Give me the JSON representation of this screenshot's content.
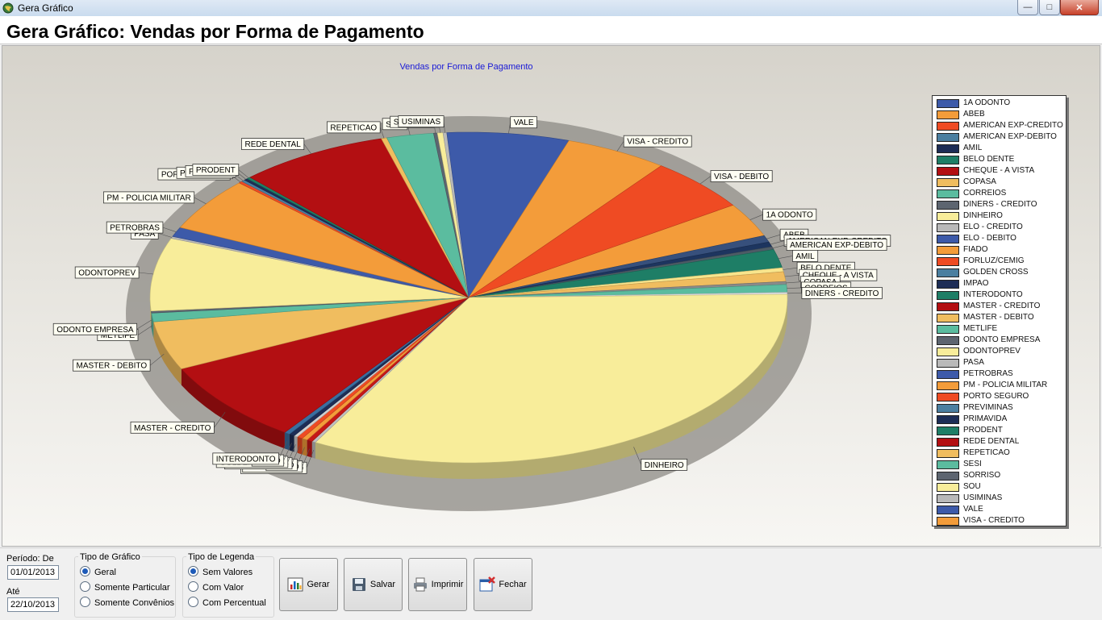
{
  "window": {
    "title": "Gera Gráfico"
  },
  "header": {
    "title": "Gera Gráfico: Vendas por Forma de Pagamento"
  },
  "chart_data": {
    "type": "pie",
    "title": "Vendas por Forma de Pagamento",
    "legend_position": "right",
    "slices": [
      {
        "label": "1A ODONTO",
        "value": 3.5,
        "color": "#f39c3a"
      },
      {
        "label": "ABEB",
        "value": 0.7,
        "color": "#37507c"
      },
      {
        "label": "AMERICAN EXP-CREDITO",
        "value": 0.5,
        "color": "#1d355f"
      },
      {
        "label": "AMERICAN EXP-DEBITO",
        "value": 0.3,
        "color": "#4d5b66"
      },
      {
        "label": "AMIL",
        "value": 1.9,
        "color": "#1e7e66"
      },
      {
        "label": "BELO DENTE",
        "value": 0.4,
        "color": "#f8e58c"
      },
      {
        "label": "CHEQUE - A VISTA",
        "value": 1.0,
        "color": "#f0bd5f"
      },
      {
        "label": "COPASA",
        "value": 0.3,
        "color": "#8a8a8a"
      },
      {
        "label": "CORREIOS",
        "value": 0.8,
        "color": "#5bbc9f"
      },
      {
        "label": "DINERS - CREDITO",
        "value": 0.2,
        "color": "#dcdcdc"
      },
      {
        "label": "DINHEIRO",
        "value": 35.0,
        "color": "#f8ed9a"
      },
      {
        "label": "ELO - CREDITO",
        "value": 0.2,
        "color": "#c0c0c0"
      },
      {
        "label": "ELO - DEBITO",
        "value": 0.3,
        "color": "#c61717"
      },
      {
        "label": "FIADO",
        "value": 0.3,
        "color": "#f39c3a"
      },
      {
        "label": "FORLUZ/CEMIG",
        "value": 0.3,
        "color": "#ef4b23"
      },
      {
        "label": "GOLDEN CROSS",
        "value": 0.2,
        "color": "#d0d0d0"
      },
      {
        "label": "IMPAO",
        "value": 0.3,
        "color": "#1d2d56"
      },
      {
        "label": "INTERODONTO",
        "value": 0.3,
        "color": "#3a6fa0"
      },
      {
        "label": "MASTER - CREDITO",
        "value": 8.5,
        "color": "#b30f12"
      },
      {
        "label": "MASTER - DEBITO",
        "value": 5.0,
        "color": "#f0bd5f"
      },
      {
        "label": "METLIFE",
        "value": 0.9,
        "color": "#5bbc9f"
      },
      {
        "label": "ODONTO EMPRESA",
        "value": 0.2,
        "color": "#5d6570"
      },
      {
        "label": "ODONTOPREV",
        "value": 7.5,
        "color": "#f8ed9a"
      },
      {
        "label": "PASA",
        "value": 0.2,
        "color": "#b9b9b9"
      },
      {
        "label": "PETROBRAS",
        "value": 1.0,
        "color": "#3d5aa9"
      },
      {
        "label": "PM - POLICIA MILITAR",
        "value": 5.5,
        "color": "#f39c3a"
      },
      {
        "label": "PORTO SEGURO",
        "value": 0.2,
        "color": "#ef4b23"
      },
      {
        "label": "PREVIMINAS",
        "value": 0.2,
        "color": "#4b7fa0"
      },
      {
        "label": "PRIMAVIDA",
        "value": 0.2,
        "color": "#1d2d56"
      },
      {
        "label": "PRODENT",
        "value": 0.2,
        "color": "#1e7e66"
      },
      {
        "label": "REDE DENTAL",
        "value": 8.0,
        "color": "#b30f12"
      },
      {
        "label": "REPETICAO",
        "value": 0.3,
        "color": "#f0bd5f"
      },
      {
        "label": "SESI",
        "value": 2.5,
        "color": "#5bbc9f"
      },
      {
        "label": "SORRISO",
        "value": 0.2,
        "color": "#5d6570"
      },
      {
        "label": "SOU",
        "value": 0.3,
        "color": "#f8ed9a"
      },
      {
        "label": "USIMINAS",
        "value": 0.2,
        "color": "#b9b9b9"
      },
      {
        "label": "VALE",
        "value": 6.5,
        "color": "#3d5aa9"
      },
      {
        "label": "VISA - CREDITO",
        "value": 5.5,
        "color": "#f39c3a"
      },
      {
        "label": "VISA - DEBITO",
        "value": 5.5,
        "color": "#ef4b23"
      }
    ]
  },
  "legend": {
    "items": [
      {
        "label": "1A ODONTO",
        "color": "#3d5aa9"
      },
      {
        "label": "ABEB",
        "color": "#f39c3a"
      },
      {
        "label": "AMERICAN EXP-CREDITO",
        "color": "#ef4b23"
      },
      {
        "label": "AMERICAN EXP-DEBITO",
        "color": "#4b7fa0"
      },
      {
        "label": "AMIL",
        "color": "#1d2d56"
      },
      {
        "label": "BELO DENTE",
        "color": "#1e7e66"
      },
      {
        "label": "CHEQUE - A VISTA",
        "color": "#b30f12"
      },
      {
        "label": "COPASA",
        "color": "#f0bd5f"
      },
      {
        "label": "CORREIOS",
        "color": "#5bbc9f"
      },
      {
        "label": "DINERS - CREDITO",
        "color": "#5d6570"
      },
      {
        "label": "DINHEIRO",
        "color": "#f8ed9a"
      },
      {
        "label": "ELO - CREDITO",
        "color": "#b9b9b9"
      },
      {
        "label": "ELO - DEBITO",
        "color": "#3d5aa9"
      },
      {
        "label": "FIADO",
        "color": "#f39c3a"
      },
      {
        "label": "FORLUZ/CEMIG",
        "color": "#ef4b23"
      },
      {
        "label": "GOLDEN CROSS",
        "color": "#4b7fa0"
      },
      {
        "label": "IMPAO",
        "color": "#1d2d56"
      },
      {
        "label": "INTERODONTO",
        "color": "#1e7e66"
      },
      {
        "label": "MASTER - CREDITO",
        "color": "#b30f12"
      },
      {
        "label": "MASTER - DEBITO",
        "color": "#f0bd5f"
      },
      {
        "label": "METLIFE",
        "color": "#5bbc9f"
      },
      {
        "label": "ODONTO EMPRESA",
        "color": "#5d6570"
      },
      {
        "label": "ODONTOPREV",
        "color": "#f8ed9a"
      },
      {
        "label": "PASA",
        "color": "#b9b9b9"
      },
      {
        "label": "PETROBRAS",
        "color": "#3d5aa9"
      },
      {
        "label": "PM - POLICIA MILITAR",
        "color": "#f39c3a"
      },
      {
        "label": "PORTO SEGURO",
        "color": "#ef4b23"
      },
      {
        "label": "PREVIMINAS",
        "color": "#4b7fa0"
      },
      {
        "label": "PRIMAVIDA",
        "color": "#1d2d56"
      },
      {
        "label": "PRODENT",
        "color": "#1e7e66"
      },
      {
        "label": "REDE DENTAL",
        "color": "#b30f12"
      },
      {
        "label": "REPETICAO",
        "color": "#f0bd5f"
      },
      {
        "label": "SESI",
        "color": "#5bbc9f"
      },
      {
        "label": "SORRISO",
        "color": "#5d6570"
      },
      {
        "label": "SOU",
        "color": "#f8ed9a"
      },
      {
        "label": "USIMINAS",
        "color": "#b9b9b9"
      },
      {
        "label": "VALE",
        "color": "#3d5aa9"
      },
      {
        "label": "VISA - CREDITO",
        "color": "#f39c3a"
      }
    ]
  },
  "filters": {
    "period_label": "Período: De",
    "from_value": "01/01/2013",
    "to_label": "Até",
    "to_value": "22/10/2013"
  },
  "chart_type_group": {
    "title": "Tipo de Gráfico",
    "options": [
      "Geral",
      "Somente Particular",
      "Somente Convênios"
    ],
    "selected": "Geral"
  },
  "legend_type_group": {
    "title": "Tipo de Legenda",
    "options": [
      "Sem Valores",
      "Com Valor",
      "Com Percentual"
    ],
    "selected": "Sem Valores"
  },
  "buttons": {
    "gerar": "Gerar",
    "salvar": "Salvar",
    "imprimir": "Imprimir",
    "fechar": "Fechar"
  },
  "window_controls": {
    "minimize": "—",
    "maximize": "□",
    "close": "✕"
  }
}
